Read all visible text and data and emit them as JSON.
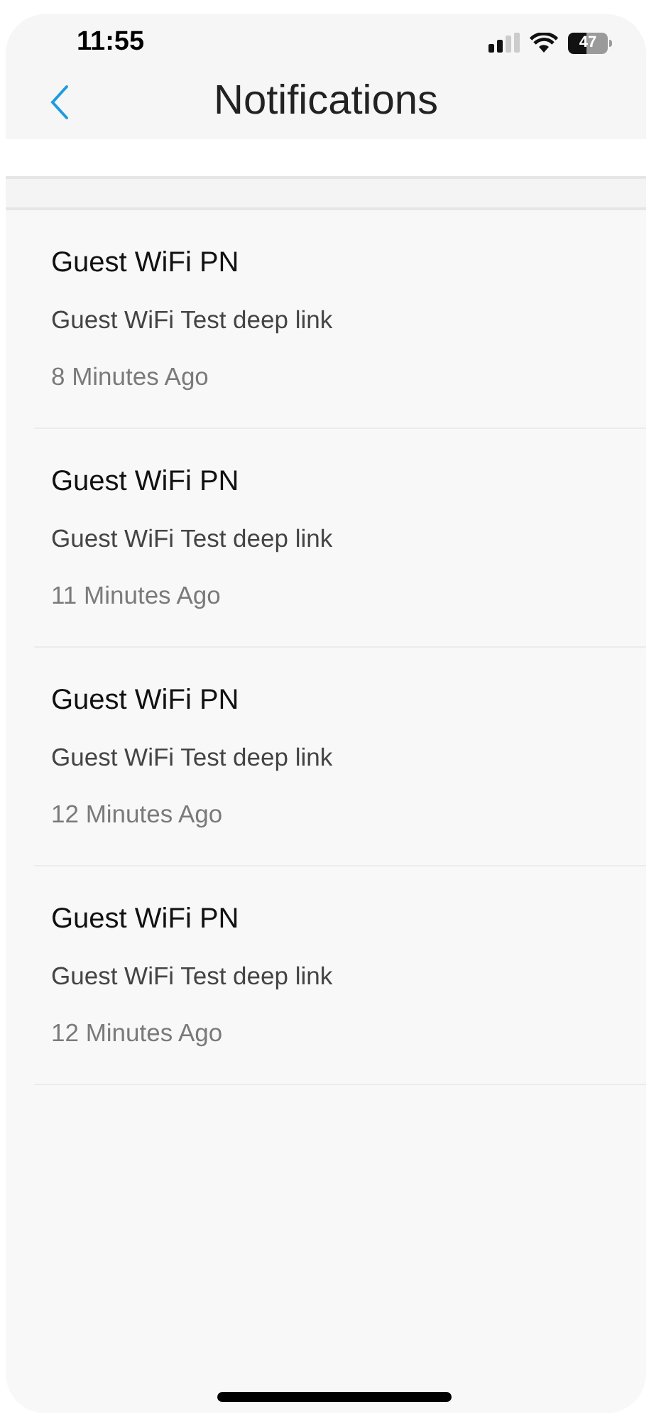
{
  "status_bar": {
    "time": "11:55",
    "battery": "47"
  },
  "header": {
    "title": "Notifications"
  },
  "notifications": [
    {
      "title": "Guest WiFi PN",
      "body": "Guest WiFi Test deep link",
      "time": "8 Minutes Ago"
    },
    {
      "title": "Guest WiFi PN",
      "body": "Guest WiFi Test deep link",
      "time": "11 Minutes Ago"
    },
    {
      "title": "Guest WiFi PN",
      "body": "Guest WiFi Test deep link",
      "time": "12 Minutes Ago"
    },
    {
      "title": "Guest WiFi PN",
      "body": "Guest WiFi Test deep link",
      "time": "12 Minutes Ago"
    }
  ]
}
